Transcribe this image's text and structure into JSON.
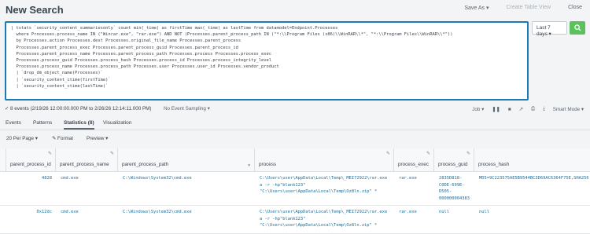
{
  "header": {
    "title": "New Search",
    "save_as": "Save As ▾",
    "create_table_view": "Create Table View",
    "close": "Close"
  },
  "query_lines": [
    "| tstats `security_content_summariesonly` count min(_time) as firstTime max(_time) as lastTime from datamodel=Endpoint.Processes",
    "  where Processes.process_name IN (\"Winrar.exe\", \"rar.exe\") AND NOT (Processes.parent_process_path IN (\"*:\\\\Program Files (x86)\\\\WinRAR\\\\*\", \"*:\\\\Program Files\\\\WinRAR\\\\*\"))",
    "  by Processes.action Processes.dest Processes.original_file_name Processes.parent_process",
    "  Processes.parent_process_exec Processes.parent_process_guid Processes.parent_process_id",
    "  Processes.parent_process_name Processes.parent_process_path Processes.process Processes.process_exec",
    "  Processes.process_guid Processes.process_hash Processes.process_id Processes.process_integrity_level",
    "  Processes.process_name Processes.process_path Processes.user Processes.user_id Processes.vendor_product",
    "  | `drop_dm_object_name(Processes)`",
    "  | `security_content_ctime(firstTime)`",
    "  | `security_content_ctime(lastTime)`"
  ],
  "time_picker": {
    "label": "Last 7 days ▾"
  },
  "status": {
    "events": "✓ 8 events (2/19/26 12:00:00.000 PM to 2/26/26 12:14:11.000 PM)",
    "sampling": "No Event Sampling ▾",
    "job": "Job ▾",
    "smart_mode": "Smart Mode ▾"
  },
  "tabs": [
    "Events",
    "Patterns",
    "Statistics (8)",
    "Visualization"
  ],
  "toolbar": {
    "per_page": "20 Per Page ▾",
    "format": "✎ Format",
    "preview": "Preview ▾"
  },
  "columns": [
    "parent_process_id",
    "parent_process_name",
    "parent_process_path",
    "process",
    "process_exec",
    "process_guid",
    "process_hash"
  ],
  "rows": [
    {
      "parent_process_id": "4828",
      "parent_process_name": "cmd.exe",
      "parent_process_path": "C:\\Windows\\System32\\cmd.exe",
      "process": "C:\\Users\\user\\AppData\\Local\\Temp\\_MEI72922\\rar.exe\na -r -hp\"blank123\"\n\"C:\\Users\\user\\AppData\\Local\\Temp\\Oz8ln.zip\" *",
      "process_exec": "rar.exe",
      "process_guid": "2835D818-\nC0DE-699E-\nD505-\n000000004383",
      "process_hash": "MD5=9C223575AE5B9544BC3D69AC6364F75E,SHA256"
    },
    {
      "parent_process_id": "0x12dc",
      "parent_process_name": "cmd.exe",
      "parent_process_path": "C:\\Windows\\System32\\cmd.exe",
      "process": "C:\\Users\\user\\AppData\\Local\\Temp\\_MEI72922\\rar.exe\na -r -hp\"blank123\"\n\"C:\\Users\\user\\AppData\\Local\\Temp\\Oz8ln.zip\" *",
      "process_exec": "rar.exe",
      "process_guid": "null",
      "process_hash": "null"
    }
  ]
}
